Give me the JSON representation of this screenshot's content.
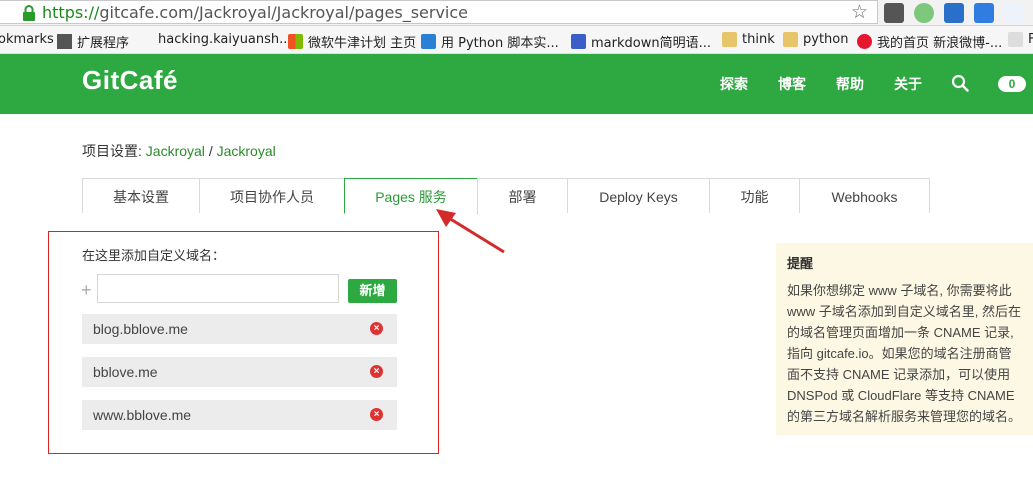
{
  "browser": {
    "url_scheme": "https://",
    "url_host": "gitcafe.com",
    "url_path": "/Jackroyal/Jackroyal/pages_service",
    "bookmarks": [
      {
        "label": "okmarks"
      },
      {
        "label": "扩展程序"
      },
      {
        "label": "hacking.kaiyuansh..."
      },
      {
        "label": "微软牛津计划 主页"
      },
      {
        "label": "用 Python 脚本实..."
      },
      {
        "label": "markdown简明语..."
      },
      {
        "label": "think"
      },
      {
        "label": "python"
      },
      {
        "label": "我的首页 新浪微博-..."
      },
      {
        "label": "F"
      }
    ]
  },
  "site": {
    "logo": "GitCafé",
    "nav": [
      "探索",
      "博客",
      "帮助",
      "关于"
    ],
    "notification_count": "0",
    "brand_color": "#2ea840"
  },
  "breadcrumb": {
    "prefix": "项目设置:",
    "owner": "Jackroyal",
    "separator": "/",
    "repo": "Jackroyal"
  },
  "tabs": [
    {
      "label": "基本设置"
    },
    {
      "label": "项目协作人员"
    },
    {
      "label": "Pages 服务"
    },
    {
      "label": "部署"
    },
    {
      "label": "Deploy Keys"
    },
    {
      "label": "功能"
    },
    {
      "label": "Webhooks"
    }
  ],
  "active_tab": "Pages 服务",
  "custom_domains": {
    "title": "在这里添加自定义域名：",
    "plus_symbol": "+",
    "input_value": "",
    "add_button": "新增",
    "domains": [
      {
        "name": "blog.bblove.me"
      },
      {
        "name": "bblove.me"
      },
      {
        "name": "www.bblove.me"
      }
    ]
  },
  "tip": {
    "title": "提醒",
    "lines": [
      "如果你想绑定 www 子域名, 你需要将此",
      "www 子域名添加到自定义域名里, 然后在",
      "的域名管理页面增加一条 CNAME 记录,",
      "指向 gitcafe.io。如果您的域名注册商管",
      "面不支持 CNAME 记录添加，可以使用",
      "DNSPod 或 CloudFlare 等支持 CNAME",
      "的第三方域名解析服务来管理您的域名。"
    ]
  }
}
